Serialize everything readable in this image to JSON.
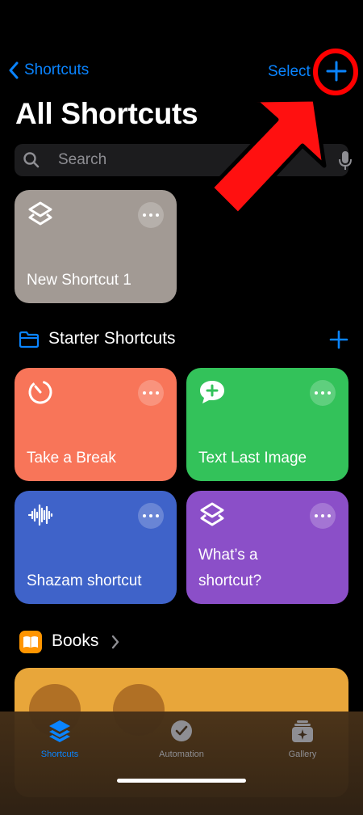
{
  "nav": {
    "back_label": "Shortcuts",
    "select_label": "Select"
  },
  "header": {
    "title": "All Shortcuts"
  },
  "search": {
    "placeholder": "Search"
  },
  "my_shortcuts": [
    {
      "label": "New Shortcut 1",
      "color": "#a29a94",
      "icon": "layers-icon"
    }
  ],
  "starter": {
    "title": "Starter Shortcuts",
    "items": [
      {
        "label": "Take a Break",
        "color": "#f87559",
        "icon": "timer-icon"
      },
      {
        "label": "Text Last Image",
        "color": "#33c25a",
        "icon": "message-plus-icon"
      },
      {
        "label": "Shazam shortcut",
        "color": "#3f63c9",
        "icon": "waveform-icon"
      },
      {
        "label_line1": "What’s a",
        "label_line2": "shortcut?",
        "color": "#8b4fc8",
        "icon": "layers-icon"
      }
    ]
  },
  "books": {
    "title": "Books",
    "color": "#e8a63a"
  },
  "tabs": [
    {
      "label": "Shortcuts",
      "active": true,
      "icon": "layers-icon"
    },
    {
      "label": "Automation",
      "active": false,
      "icon": "clock-check-icon"
    },
    {
      "label": "Gallery",
      "active": false,
      "icon": "gallery-icon"
    }
  ],
  "colors": {
    "accent": "#0a84ff",
    "annotation": "#ff0000"
  }
}
